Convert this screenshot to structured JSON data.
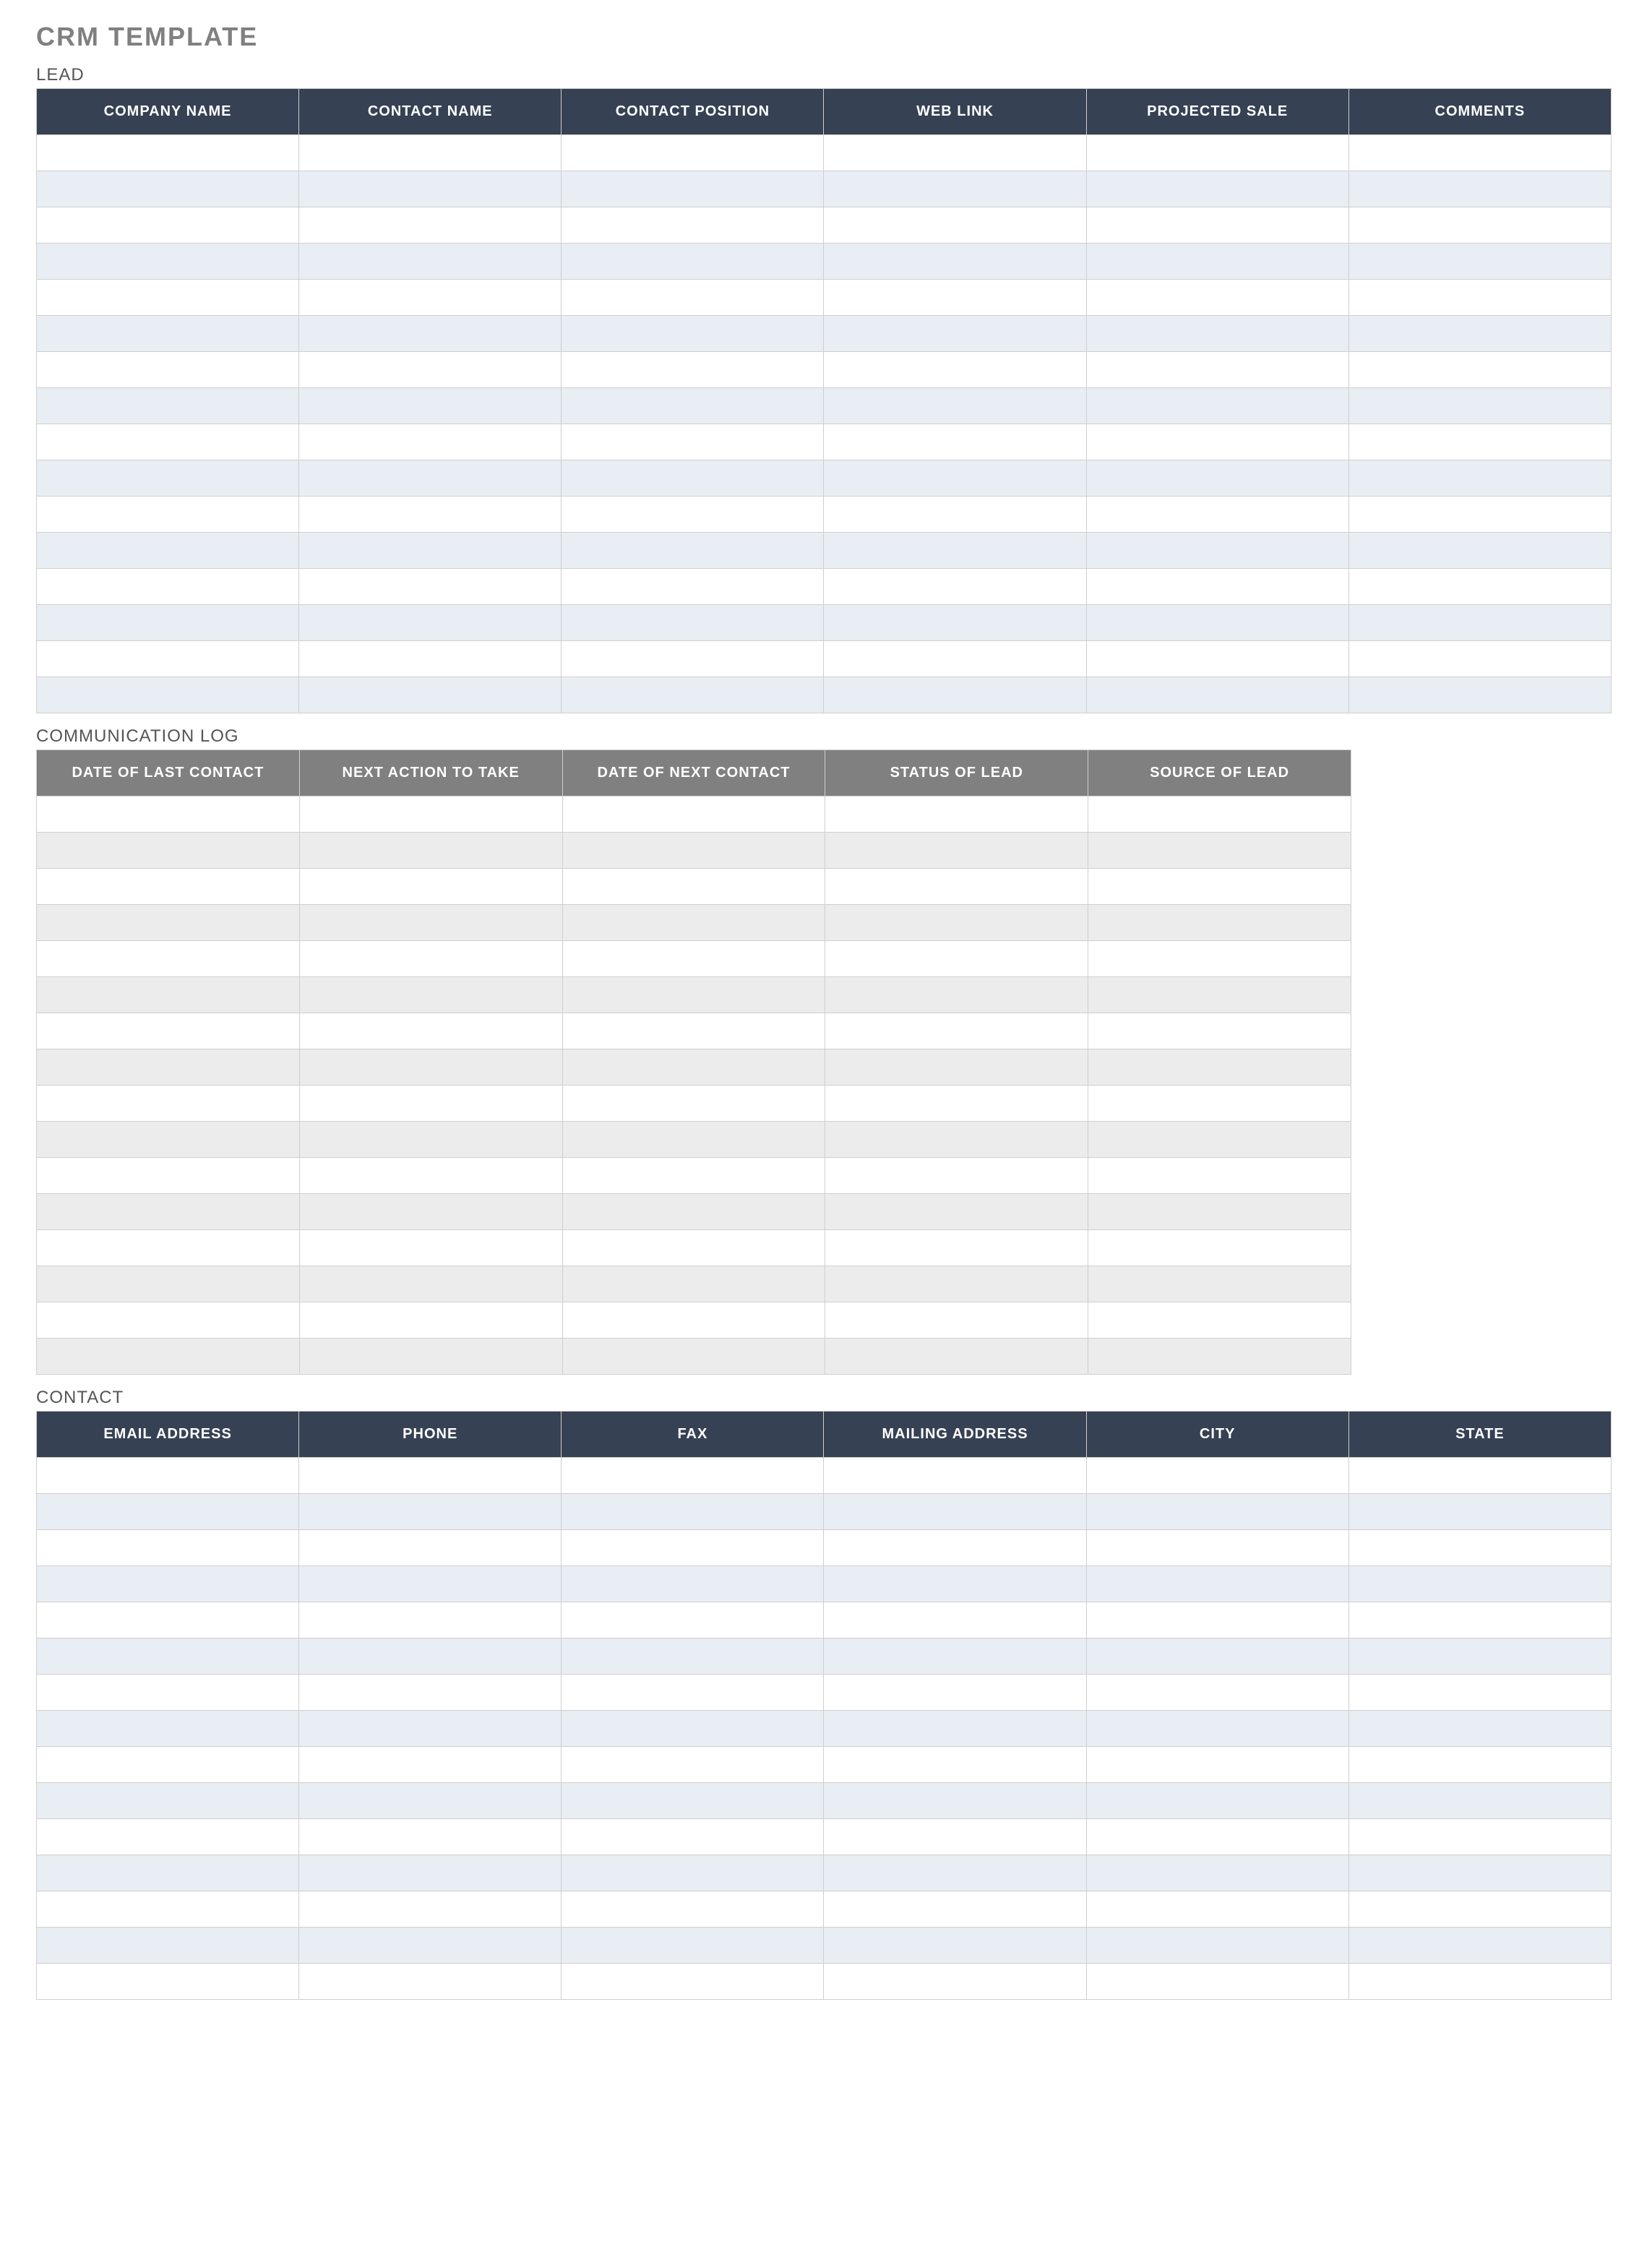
{
  "title": "CRM TEMPLATE",
  "sections": {
    "lead": {
      "label": "LEAD",
      "headers": [
        "COMPANY NAME",
        "CONTACT NAME",
        "CONTACT POSITION",
        "WEB LINK",
        "PROJECTED SALE",
        "COMMENTS"
      ],
      "rowCount": 16,
      "rows": [
        [
          "",
          "",
          "",
          "",
          "",
          ""
        ],
        [
          "",
          "",
          "",
          "",
          "",
          ""
        ],
        [
          "",
          "",
          "",
          "",
          "",
          ""
        ],
        [
          "",
          "",
          "",
          "",
          "",
          ""
        ],
        [
          "",
          "",
          "",
          "",
          "",
          ""
        ],
        [
          "",
          "",
          "",
          "",
          "",
          ""
        ],
        [
          "",
          "",
          "",
          "",
          "",
          ""
        ],
        [
          "",
          "",
          "",
          "",
          "",
          ""
        ],
        [
          "",
          "",
          "",
          "",
          "",
          ""
        ],
        [
          "",
          "",
          "",
          "",
          "",
          ""
        ],
        [
          "",
          "",
          "",
          "",
          "",
          ""
        ],
        [
          "",
          "",
          "",
          "",
          "",
          ""
        ],
        [
          "",
          "",
          "",
          "",
          "",
          ""
        ],
        [
          "",
          "",
          "",
          "",
          "",
          ""
        ],
        [
          "",
          "",
          "",
          "",
          "",
          ""
        ],
        [
          "",
          "",
          "",
          "",
          "",
          ""
        ]
      ]
    },
    "comm": {
      "label": "COMMUNICATION LOG",
      "headers": [
        "DATE OF LAST CONTACT",
        "NEXT ACTION TO TAKE",
        "DATE OF NEXT CONTACT",
        "STATUS OF LEAD",
        "SOURCE OF LEAD"
      ],
      "rowCount": 16,
      "rows": [
        [
          "",
          "",
          "",
          "",
          ""
        ],
        [
          "",
          "",
          "",
          "",
          ""
        ],
        [
          "",
          "",
          "",
          "",
          ""
        ],
        [
          "",
          "",
          "",
          "",
          ""
        ],
        [
          "",
          "",
          "",
          "",
          ""
        ],
        [
          "",
          "",
          "",
          "",
          ""
        ],
        [
          "",
          "",
          "",
          "",
          ""
        ],
        [
          "",
          "",
          "",
          "",
          ""
        ],
        [
          "",
          "",
          "",
          "",
          ""
        ],
        [
          "",
          "",
          "",
          "",
          ""
        ],
        [
          "",
          "",
          "",
          "",
          ""
        ],
        [
          "",
          "",
          "",
          "",
          ""
        ],
        [
          "",
          "",
          "",
          "",
          ""
        ],
        [
          "",
          "",
          "",
          "",
          ""
        ],
        [
          "",
          "",
          "",
          "",
          ""
        ],
        [
          "",
          "",
          "",
          "",
          ""
        ]
      ]
    },
    "contact": {
      "label": "CONTACT",
      "headers": [
        "EMAIL ADDRESS",
        "PHONE",
        "FAX",
        "MAILING ADDRESS",
        "CITY",
        "STATE"
      ],
      "rowCount": 15,
      "rows": [
        [
          "",
          "",
          "",
          "",
          "",
          ""
        ],
        [
          "",
          "",
          "",
          "",
          "",
          ""
        ],
        [
          "",
          "",
          "",
          "",
          "",
          ""
        ],
        [
          "",
          "",
          "",
          "",
          "",
          ""
        ],
        [
          "",
          "",
          "",
          "",
          "",
          ""
        ],
        [
          "",
          "",
          "",
          "",
          "",
          ""
        ],
        [
          "",
          "",
          "",
          "",
          "",
          ""
        ],
        [
          "",
          "",
          "",
          "",
          "",
          ""
        ],
        [
          "",
          "",
          "",
          "",
          "",
          ""
        ],
        [
          "",
          "",
          "",
          "",
          "",
          ""
        ],
        [
          "",
          "",
          "",
          "",
          "",
          ""
        ],
        [
          "",
          "",
          "",
          "",
          "",
          ""
        ],
        [
          "",
          "",
          "",
          "",
          "",
          ""
        ],
        [
          "",
          "",
          "",
          "",
          "",
          ""
        ],
        [
          "",
          "",
          "",
          "",
          "",
          ""
        ]
      ]
    }
  }
}
